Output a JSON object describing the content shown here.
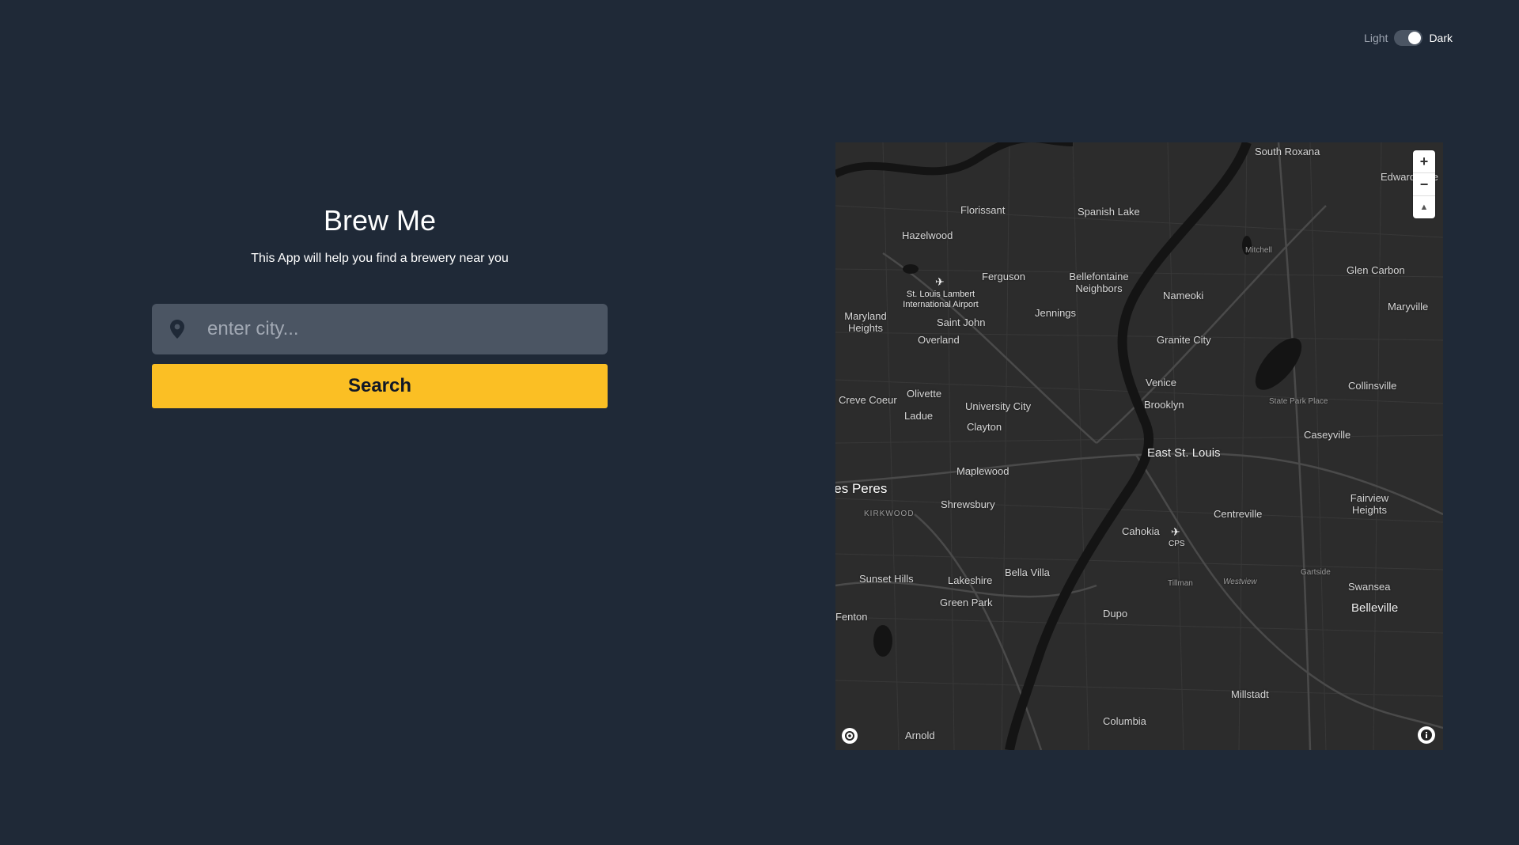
{
  "theme_toggle": {
    "light_label": "Light",
    "dark_label": "Dark",
    "state": "dark"
  },
  "hero": {
    "title": "Brew Me",
    "subtitle": "This App will help you find a brewery near you"
  },
  "search": {
    "placeholder": "enter city...",
    "value": "",
    "button_label": "Search",
    "icon": "map-pin-icon"
  },
  "colors": {
    "background": "#1f2937",
    "input_bg": "#4b5563",
    "accent": "#fbbf24",
    "map_bg": "#2c2c2c"
  },
  "map": {
    "controls": {
      "zoom_in": "+",
      "zoom_out": "−",
      "compass": "▲"
    },
    "airport_symbol": "✈",
    "places": [
      "South Roxana",
      "Edwardsville",
      "Florissant",
      "Spanish Lake",
      "Hazelwood",
      "Mitchell",
      "Glen Carbon",
      "Ferguson",
      "Bellefontaine Neighbors",
      "St. Louis Lambert International Airport",
      "Nameoki",
      "Maryland Heights",
      "Saint John",
      "Jennings",
      "Maryville",
      "Overland",
      "Granite City",
      "Venice",
      "Olivette",
      "Collinsville",
      "Creve Coeur",
      "University City",
      "Brooklyn",
      "State Park Place",
      "Ladue",
      "Clayton",
      "Caseyville",
      "East St. Louis",
      "Maplewood",
      "Des Peres",
      "Fairview Heights",
      "Shrewsbury",
      "Centreville",
      "KIRKWOOD",
      "Cahokia",
      "CPS",
      "Sunset Hills",
      "Lakeshire",
      "Bella Villa",
      "Gartside",
      "Tillman",
      "Westview",
      "Swansea",
      "Green Park",
      "Belleville",
      "Fenton",
      "Dupo",
      "Millstadt",
      "Columbia",
      "Arnold"
    ]
  }
}
